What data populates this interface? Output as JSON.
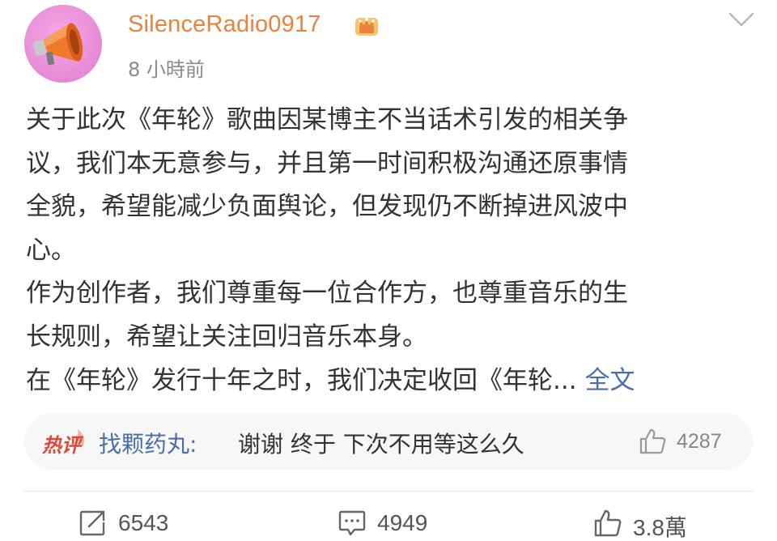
{
  "post": {
    "author": {
      "username": "SilenceRadio0917",
      "avatar_icon": "megaphone-icon",
      "badge_icon": "crown-icon",
      "name_color": "#e8823c"
    },
    "timestamp": "8 小時前",
    "content_lines": [
      "关于此次《年轮》歌曲因某博主不当话术引发的相关争",
      "议，我们本无意参与，并且第一时间积极沟通还原事情",
      "全貌，希望能减少负面舆论，但发现仍不断掉进风波中",
      "心。",
      "作为创作者，我们尊重每一位合作方，也尊重音乐的生",
      "长规则，希望让关注回归音乐本身。",
      "在《年轮》发行十年之时，我们决定收回《年轮..."
    ],
    "more_link": "全文",
    "link_color": "#4a6ea9"
  },
  "hot_comment": {
    "tag": "热评",
    "user": "找颗药丸",
    "text": "谢谢 终于 下次不用等这么久",
    "like_count": "4287"
  },
  "actions": {
    "repost_count": "6543",
    "comment_count": "4949",
    "like_count": "3.8萬"
  }
}
